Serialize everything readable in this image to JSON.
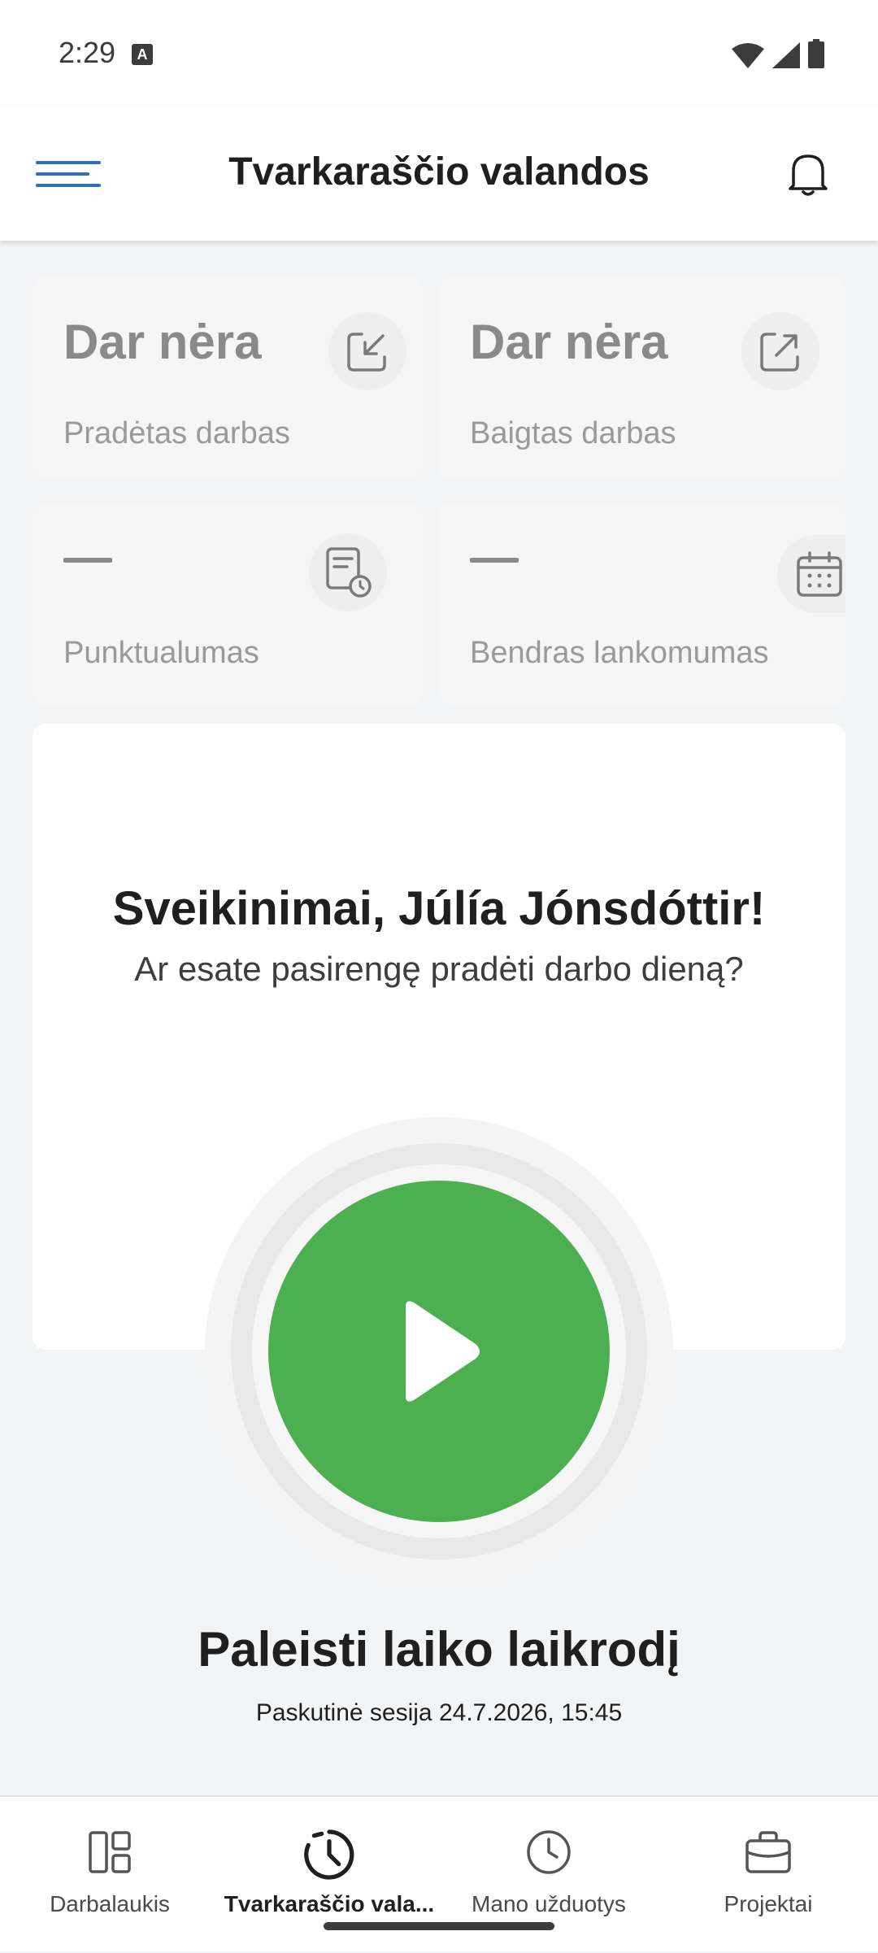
{
  "status_bar": {
    "time": "2:29"
  },
  "header": {
    "title": "Tvarkaraščio valandos"
  },
  "stats": [
    {
      "value": "Dar nėra",
      "label": "Pradėtas darbas",
      "icon": "clock-in-icon"
    },
    {
      "value": "Dar nėra",
      "label": "Baigtas darbas",
      "icon": "clock-out-icon"
    },
    {
      "value": "—",
      "label": "Punktualumas",
      "icon": "punctuality-icon"
    },
    {
      "value": "—",
      "label": "Bendras lankomumas",
      "icon": "calendar-icon"
    }
  ],
  "welcome": {
    "title": "Sveikinimai, Júlía Jónsdóttir!",
    "subtitle": "Ar esate pasirengę pradėti darbo dieną?"
  },
  "clock": {
    "start_label": "Paleisti laiko laikrodį",
    "last_session": "Paskutinė sesija 24.7.2026, 15:45",
    "button_color": "#4caf50"
  },
  "bottom_nav": {
    "items": [
      {
        "label": "Darbalaukis",
        "icon": "dashboard-icon",
        "active": false
      },
      {
        "label": "Tvarkaraščio vala...",
        "icon": "timesheet-icon",
        "active": true
      },
      {
        "label": "Mano užduotys",
        "icon": "tasks-clock-icon",
        "active": false
      },
      {
        "label": "Projektai",
        "icon": "briefcase-icon",
        "active": false
      }
    ]
  },
  "colors": {
    "accent": "#2f6db5",
    "success": "#4caf50"
  }
}
